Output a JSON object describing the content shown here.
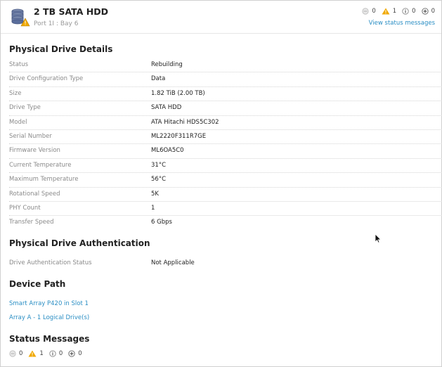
{
  "header": {
    "title": "2 TB SATA HDD",
    "subtitle": "Port 1I : Bay 6",
    "status_counts": {
      "critical": "0",
      "warning": "1",
      "info": "0",
      "unknown": "0"
    },
    "view_status_link": "View status messages"
  },
  "physical_drive_details": {
    "heading": "Physical Drive Details",
    "rows": [
      {
        "label": "Status",
        "value": "Rebuilding"
      },
      {
        "label": "Drive Configuration Type",
        "value": "Data"
      },
      {
        "label": "Size",
        "value": "1.82 TiB (2.00 TB)"
      },
      {
        "label": "Drive Type",
        "value": "SATA HDD"
      },
      {
        "label": "Model",
        "value": "ATA Hitachi HDS5C302"
      },
      {
        "label": "Serial Number",
        "value": "ML2220F311R7GE"
      },
      {
        "label": "Firmware Version",
        "value": "ML6OA5C0"
      },
      {
        "label": "Current Temperature",
        "value": "31°C"
      },
      {
        "label": "Maximum Temperature",
        "value": "56°C"
      },
      {
        "label": "Rotational Speed",
        "value": "5K"
      },
      {
        "label": "PHY Count",
        "value": "1"
      },
      {
        "label": "Transfer Speed",
        "value": "6 Gbps"
      }
    ]
  },
  "authentication": {
    "heading": "Physical Drive Authentication",
    "rows": [
      {
        "label": "Drive Authentication Status",
        "value": "Not Applicable"
      }
    ]
  },
  "device_path": {
    "heading": "Device Path",
    "links": [
      "Smart Array P420 in Slot 1",
      "Array A - 1 Logical Drive(s)"
    ]
  },
  "status_messages": {
    "heading": "Status Messages",
    "counts": {
      "critical": "0",
      "warning": "1",
      "info": "0",
      "unknown": "0"
    }
  },
  "colors": {
    "link": "#2a8ec4",
    "warning": "#f0a800",
    "drive": "#5a6e9c"
  }
}
